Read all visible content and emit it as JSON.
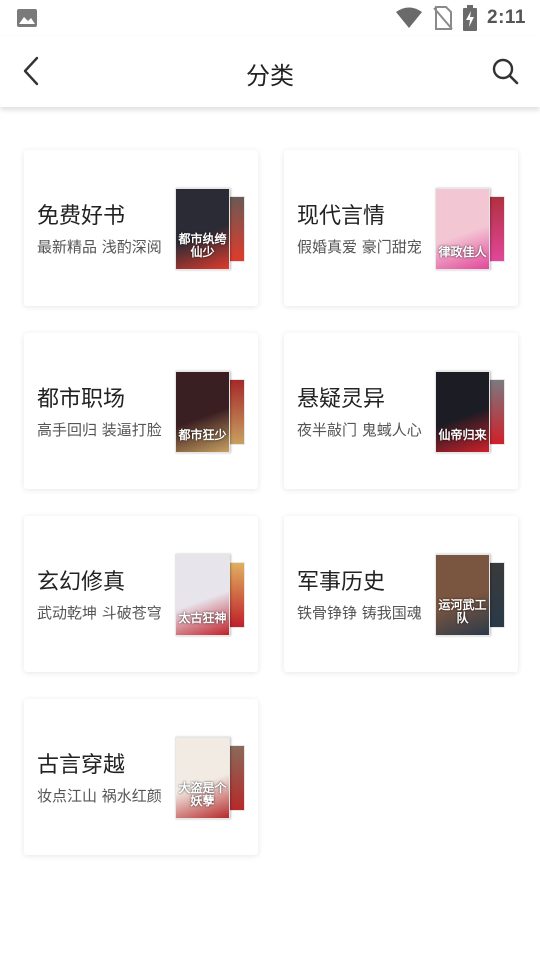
{
  "status_bar": {
    "time": "2:11"
  },
  "header": {
    "title": "分类"
  },
  "categories": [
    {
      "name": "免费好书",
      "desc": "最新精品 浅酌深阅",
      "cover_text": "都市纨绔仙少",
      "cover_bg": "#2b2b35",
      "cover_accent": "#e03b2c",
      "back_bg": "#6b5a55"
    },
    {
      "name": "现代言情",
      "desc": "假婚真爱 豪门甜宠",
      "cover_text": "律政佳人",
      "cover_bg": "#f3c6d4",
      "cover_accent": "#e2479a",
      "back_bg": "#b03040"
    },
    {
      "name": "都市职场",
      "desc": "高手回归 装逼打脸",
      "cover_text": "都市狂少",
      "cover_bg": "#3a1f22",
      "cover_accent": "#c8a060",
      "back_bg": "#a52a2a"
    },
    {
      "name": "悬疑灵异",
      "desc": "夜半敲门 鬼蜮人心",
      "cover_text": "仙帝归来",
      "cover_bg": "#1c1c24",
      "cover_accent": "#d0202a",
      "back_bg": "#7a7a80"
    },
    {
      "name": "玄幻修真",
      "desc": "武动乾坤 斗破苍穹",
      "cover_text": "太古狂神",
      "cover_bg": "#e8e4ec",
      "cover_accent": "#c0202a",
      "back_bg": "#e0b060"
    },
    {
      "name": "军事历史",
      "desc": "铁骨铮铮 铸我国魂",
      "cover_text": "运河武工队",
      "cover_bg": "#7a5540",
      "cover_accent": "#2a3a4a",
      "back_bg": "#3a3a3a"
    },
    {
      "name": "古言穿越",
      "desc": "妆点江山 祸水红颜",
      "cover_text": "大盗是个妖孽",
      "cover_bg": "#f1ebe4",
      "cover_accent": "#b52a2a",
      "back_bg": "#8a6a5a"
    }
  ]
}
